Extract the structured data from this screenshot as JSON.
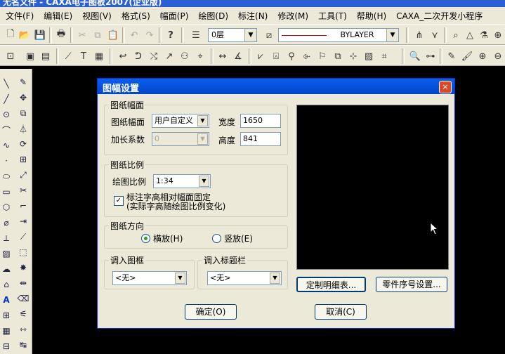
{
  "app": {
    "title": "无名文件 - CAXA电子图板2007(企业版)"
  },
  "menu": [
    "文件(F)",
    "编辑(E)",
    "视图(V)",
    "格式(S)",
    "幅面(P)",
    "绘图(D)",
    "标注(N)",
    "修改(M)",
    "工具(T)",
    "帮助(H)",
    "CAXA_二次开发小程序"
  ],
  "toolbar": {
    "layer": "0层",
    "linetype": "BYLAYER"
  },
  "dialog": {
    "title": "图幅设置",
    "close": "×",
    "sheet": {
      "group": "图纸幅面",
      "size_label": "图纸幅面",
      "size_value": "用户自定义",
      "width_label": "宽度",
      "width_value": "1650",
      "ext_label": "加长系数",
      "ext_value": "0",
      "height_label": "高度",
      "height_value": "841"
    },
    "scale": {
      "group": "图纸比例",
      "label": "绘图比例",
      "value": "1:34",
      "fixed_label_1": "标注字高相对幅面固定",
      "fixed_label_2": "(实际字高随绘图比例变化)",
      "fixed_checked": true
    },
    "orientation": {
      "group": "图纸方向",
      "landscape": "横放(H)",
      "portrait": "竖放(E)",
      "selected": "landscape"
    },
    "frame": {
      "group": "调入图框",
      "value": "<无>"
    },
    "titleblock": {
      "group": "调入标题栏",
      "value": "<无>"
    },
    "buttons": {
      "custom_table": "定制明细表...",
      "part_number": "零件序号设置...",
      "ok": "确定(O)",
      "cancel": "取消(C)"
    }
  }
}
